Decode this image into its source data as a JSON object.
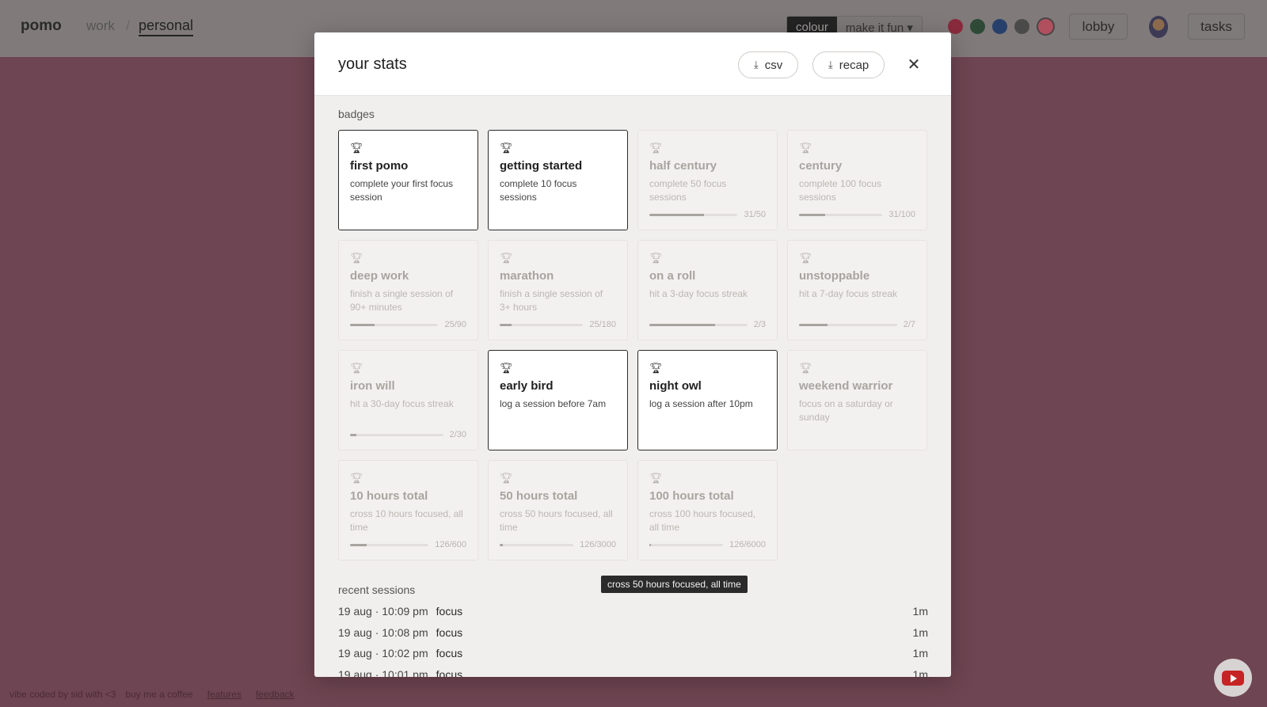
{
  "app": {
    "brand": "pomo",
    "nav": {
      "work": "work",
      "separator": "/",
      "personal": "personal"
    },
    "mode_toggle": {
      "active": "colour",
      "inactive": "make it fun ▾"
    },
    "swatches": [
      "#8a2b3d",
      "#2e4a36",
      "#27406b",
      "#4a4a4a",
      "#b0505f"
    ],
    "lobby_label": "lobby",
    "tasks_label": "tasks",
    "footer": {
      "credit": "vibe coded by sid with <3",
      "coffee": "buy me a coffee",
      "features": "features",
      "feedback": "feedback"
    }
  },
  "modal": {
    "title": "your stats",
    "csv_label": "csv",
    "recap_label": "recap",
    "close_label": "✕",
    "badges_label": "badges",
    "badges": [
      {
        "name": "first pomo",
        "desc": "complete your first focus session",
        "earned": true
      },
      {
        "name": "getting started",
        "desc": "complete 10 focus sessions",
        "earned": true
      },
      {
        "name": "half century",
        "desc": "complete 50 focus sessions",
        "earned": false,
        "progress": 0.62,
        "count": "31/50"
      },
      {
        "name": "century",
        "desc": "complete 100 focus sessions",
        "earned": false,
        "progress": 0.31,
        "count": "31/100"
      },
      {
        "name": "deep work",
        "desc": "finish a single session of 90+ minutes",
        "earned": false,
        "progress": 0.28,
        "count": "25/90"
      },
      {
        "name": "marathon",
        "desc": "finish a single session of 3+ hours",
        "earned": false,
        "progress": 0.14,
        "count": "25/180"
      },
      {
        "name": "on a roll",
        "desc": "hit a 3-day focus streak",
        "earned": false,
        "progress": 0.67,
        "count": "2/3"
      },
      {
        "name": "unstoppable",
        "desc": "hit a 7-day focus streak",
        "earned": false,
        "progress": 0.29,
        "count": "2/7"
      },
      {
        "name": "iron will",
        "desc": "hit a 30-day focus streak",
        "earned": false,
        "progress": 0.07,
        "count": "2/30"
      },
      {
        "name": "early bird",
        "desc": "log a session before 7am",
        "earned": true
      },
      {
        "name": "night owl",
        "desc": "log a session after 10pm",
        "earned": true
      },
      {
        "name": "weekend warrior",
        "desc": "focus on a saturday or sunday",
        "earned": false
      },
      {
        "name": "10 hours total",
        "desc": "cross 10 hours focused, all time",
        "earned": false,
        "progress": 0.21,
        "count": "126/600"
      },
      {
        "name": "50 hours total",
        "desc": "cross 50 hours focused, all time",
        "earned": false,
        "progress": 0.04,
        "count": "126/3000"
      },
      {
        "name": "100 hours total",
        "desc": "cross 100 hours focused, all time",
        "earned": false,
        "progress": 0.02,
        "count": "126/6000"
      }
    ],
    "tooltip": "cross 50 hours focused, all time",
    "recent_label": "recent sessions",
    "sessions": [
      {
        "time": "19 aug · 10:09 pm",
        "type": "focus",
        "duration": "1m"
      },
      {
        "time": "19 aug · 10:08 pm",
        "type": "focus",
        "duration": "1m"
      },
      {
        "time": "19 aug · 10:02 pm",
        "type": "focus",
        "duration": "1m"
      },
      {
        "time": "19 aug · 10:01 pm",
        "type": "focus",
        "duration": "1m"
      }
    ]
  }
}
